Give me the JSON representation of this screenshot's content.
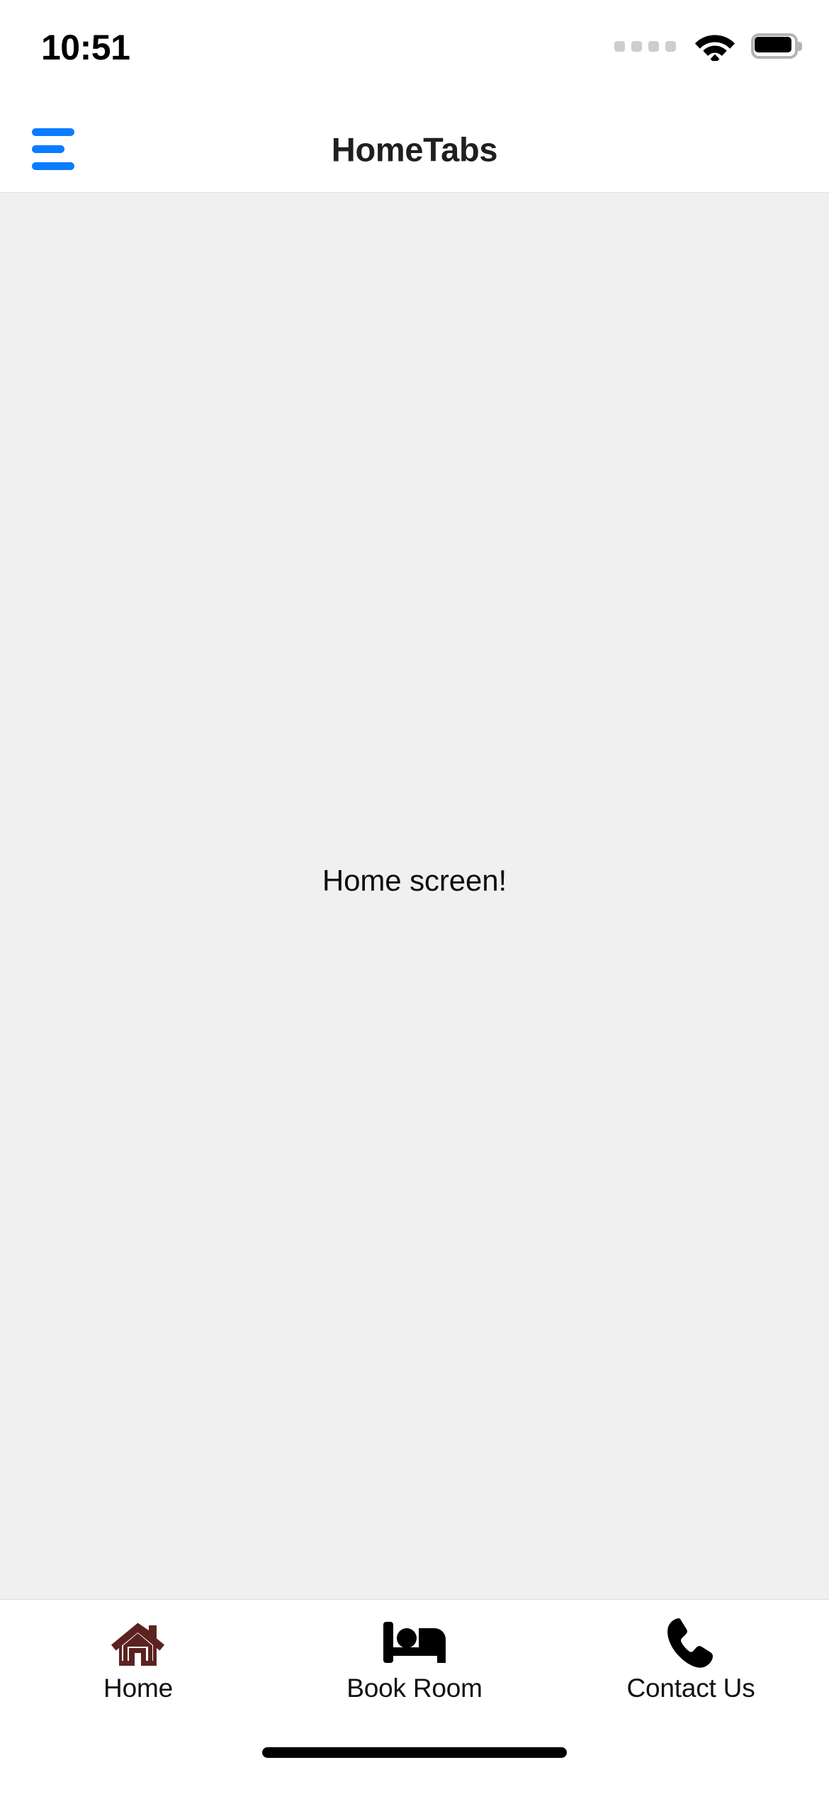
{
  "status_bar": {
    "time": "10:51",
    "signal_icon": "signal-dots-icon",
    "wifi_icon": "wifi-icon",
    "battery_icon": "battery-full-icon",
    "dot_color": "#cdcdcd",
    "battery_outline_color": "#b4b4b4"
  },
  "header": {
    "menu_icon": "hamburger-menu-icon",
    "menu_color": "#0a7cff",
    "title": "HomeTabs",
    "title_color": "#1f1f20",
    "background": "#ffffff"
  },
  "content": {
    "text": "Home screen!",
    "background": "#f0f0f0",
    "text_color": "#0d0d0d"
  },
  "tab_bar": {
    "background": "#ffffff",
    "active_color": "#5c2220",
    "inactive_color": "#000000",
    "label_color": "#111111",
    "items": [
      {
        "label": "Home",
        "icon": "house-icon",
        "active": true,
        "color": "#5c2220"
      },
      {
        "label": "Book Room",
        "icon": "bed-icon",
        "active": false,
        "color": "#000000"
      },
      {
        "label": "Contact Us",
        "icon": "phone-icon",
        "active": false,
        "color": "#000000"
      }
    ]
  },
  "home_indicator": {
    "color": "#000000"
  }
}
